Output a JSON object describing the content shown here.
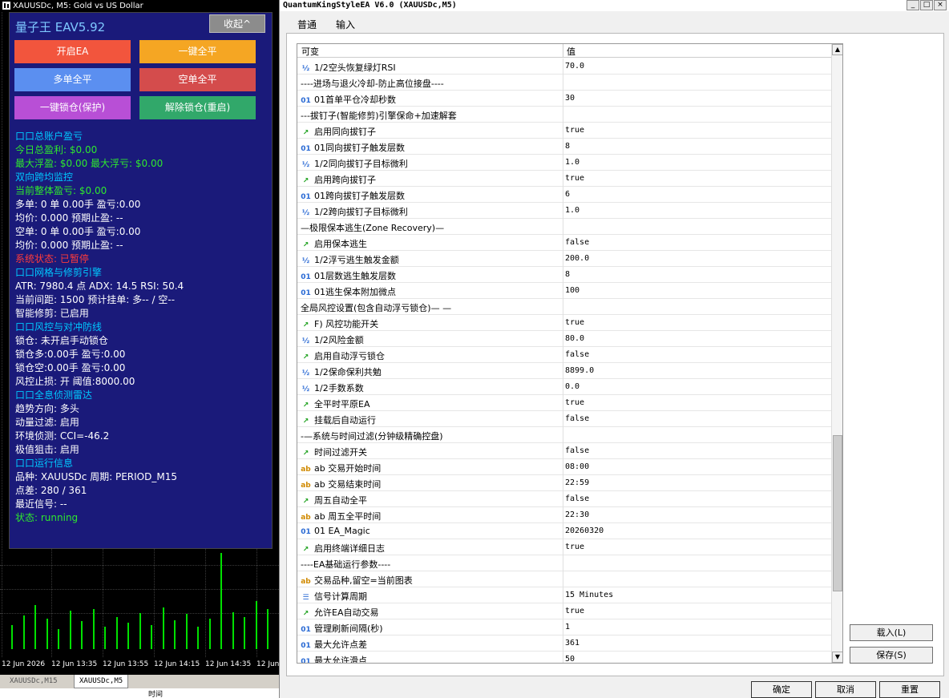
{
  "chart_window": {
    "title": "XAUUSDc, M5:  Gold vs US Dollar",
    "time_labels": [
      "12 Jun 2026",
      "12 Jun 13:35",
      "12 Jun 13:55",
      "12 Jun 14:15",
      "12 Jun 14:35",
      "12 Jun"
    ],
    "tabs": [
      "XAUUSDc,M15",
      "XAUUSDc,M5"
    ],
    "bottom_label": "时间"
  },
  "ea_panel": {
    "title": "量子王 EAV5.92",
    "collapse_label": "收起^",
    "buttons": {
      "start": "开启EA",
      "close_all": "一键全平",
      "close_long": "多单全平",
      "close_short": "空单全平",
      "lock": "一键锁仓(保护)",
      "unlock": "解除锁仓(重启)"
    },
    "lines": [
      {
        "text": "口口总账户盈亏",
        "color": "cyan"
      },
      {
        "text": "今日总盈利: $0.00",
        "color": "green"
      },
      {
        "text": "最大浮盈: $0.00     最大浮亏: $0.00",
        "color": "green"
      },
      {
        "text": "双向跨均监控",
        "color": "cyan"
      },
      {
        "text": "当前整体盈亏: $0.00",
        "color": "green"
      },
      {
        "text": "多单: 0 单 0.00手 盈亏:0.00",
        "color": "white"
      },
      {
        "text": "均价: 0.000 预期止盈: --",
        "color": "white"
      },
      {
        "text": "空单: 0 单 0.00手 盈亏:0.00",
        "color": "white"
      },
      {
        "text": "均价: 0.000 预期止盈: --",
        "color": "white"
      },
      {
        "text": "系统状态: 已暂停",
        "color": "red"
      },
      {
        "text": "口口网格与修剪引擎",
        "color": "cyan"
      },
      {
        "text": "ATR: 7980.4 点  ADX: 14.5  RSI: 50.4",
        "color": "white"
      },
      {
        "text": "当前间距: 1500  预计挂单: 多-- / 空--",
        "color": "white"
      },
      {
        "text": "智能修剪: 已启用",
        "color": "white"
      },
      {
        "text": "口口风控与对冲防线",
        "color": "cyan"
      },
      {
        "text": "锁仓: 未开启手动锁仓",
        "color": "white"
      },
      {
        "text": "锁仓多:0.00手 盈亏:0.00",
        "color": "white"
      },
      {
        "text": "锁仓空:0.00手 盈亏:0.00",
        "color": "white"
      },
      {
        "text": "风控止损: 开  阈值:8000.00",
        "color": "white"
      },
      {
        "text": "口口全息侦测雷达",
        "color": "cyan"
      },
      {
        "text": "趋势方向: 多头",
        "color": "white"
      },
      {
        "text": "动量过滤: 启用",
        "color": "white"
      },
      {
        "text": "环境侦测: CCI=-46.2",
        "color": "white"
      },
      {
        "text": "极值狙击: 启用",
        "color": "white"
      },
      {
        "text": "口口运行信息",
        "color": "cyan"
      },
      {
        "text": "品种: XAUUSDc  周期: PERIOD_M15",
        "color": "white"
      },
      {
        "text": "点差: 280 / 361",
        "color": "white"
      },
      {
        "text": "最近信号: --",
        "color": "white"
      },
      {
        "text": "状态: running",
        "color": "green"
      }
    ]
  },
  "dialog": {
    "title": "QuantumKingStyleEA V6.0 (XAUUSDc,M5)",
    "tabs": {
      "common": "普通",
      "input": "输入"
    },
    "columns": {
      "name": "可变",
      "value": "值"
    },
    "rows": [
      {
        "icon": "½",
        "type": "dbl",
        "name": "1/2空头恢复绿灯RSI",
        "value": "70.0"
      },
      {
        "icon": "",
        "type": "section",
        "name": "----进场与退火冷却-防止高位接盘----",
        "value": ""
      },
      {
        "icon": "01",
        "type": "int",
        "name": "01首单平仓冷却秒数",
        "value": "30"
      },
      {
        "icon": "",
        "type": "section",
        "name": "---拔钉子(智能修剪)引擎保命+加速解套",
        "value": ""
      },
      {
        "icon": "↗",
        "type": "bool",
        "name": "启用同向拔钉子",
        "value": "true"
      },
      {
        "icon": "01",
        "type": "int",
        "name": "01同向拔钉子触发层数",
        "value": "8"
      },
      {
        "icon": "½",
        "type": "dbl",
        "name": "1/2同向拔钉子目标微利",
        "value": "1.0"
      },
      {
        "icon": "↗",
        "type": "bool",
        "name": "启用跨向拔钉子",
        "value": "true"
      },
      {
        "icon": "01",
        "type": "int",
        "name": "01跨向拔钉子触发层数",
        "value": "6"
      },
      {
        "icon": "½",
        "type": "dbl",
        "name": "1/2跨向拔钉子目标微利",
        "value": "1.0"
      },
      {
        "icon": "",
        "type": "section",
        "name": "—极限保本逃生(Zone Recovery)—",
        "value": ""
      },
      {
        "icon": "↗",
        "type": "bool",
        "name": "启用保本逃生",
        "value": "false"
      },
      {
        "icon": "½",
        "type": "dbl",
        "name": "1/2浮亏逃生触发金额",
        "value": "200.0"
      },
      {
        "icon": "01",
        "type": "int",
        "name": "01层数逃生触发层数",
        "value": "8"
      },
      {
        "icon": "01",
        "type": "int",
        "name": "01逃生保本附加微点",
        "value": "100"
      },
      {
        "icon": "",
        "type": "section",
        "name": "全局风控设置(包含自动浮亏锁仓)— —",
        "value": ""
      },
      {
        "icon": "↗",
        "type": "bool",
        "name": "F) 风控功能开关",
        "value": "true"
      },
      {
        "icon": "½",
        "type": "dbl",
        "name": "1/2风险金额",
        "value": "80.0"
      },
      {
        "icon": "↗",
        "type": "bool",
        "name": "启用自动浮亏锁仓",
        "value": "false"
      },
      {
        "icon": "½",
        "type": "dbl",
        "name": "1/2保命保利共勉",
        "value": "8899.0"
      },
      {
        "icon": "½",
        "type": "dbl",
        "name": "1/2手数系数",
        "value": "0.0"
      },
      {
        "icon": "↗",
        "type": "bool",
        "name": "全平时平原EA",
        "value": "true"
      },
      {
        "icon": "↗",
        "type": "bool",
        "name": "挂载后自动运行",
        "value": "false"
      },
      {
        "icon": "",
        "type": "section",
        "name": "-—系统与时间过滤(分钟级精确控盘)",
        "value": ""
      },
      {
        "icon": "↗",
        "type": "bool",
        "name": "时间过滤开关",
        "value": "false"
      },
      {
        "icon": "ab",
        "type": "str",
        "name": "ab 交易开始时间",
        "value": "08:00"
      },
      {
        "icon": "ab",
        "type": "str",
        "name": "ab 交易结束时间",
        "value": "22:59"
      },
      {
        "icon": "↗",
        "type": "bool",
        "name": "周五自动全平",
        "value": "false"
      },
      {
        "icon": "ab",
        "type": "str",
        "name": "ab 周五全平时间",
        "value": "22:30"
      },
      {
        "icon": "01",
        "type": "int",
        "name": "01 EA_Magic",
        "value": "20260320"
      },
      {
        "icon": "↗",
        "type": "bool",
        "name": "启用终端详细日志",
        "value": "true"
      },
      {
        "icon": "",
        "type": "section",
        "name": "----EA基础运行参数----",
        "value": ""
      },
      {
        "icon": "ab",
        "type": "str",
        "name": "交易品种,留空=当前图表",
        "value": ""
      },
      {
        "icon": "☰",
        "type": "enum",
        "name": "信号计算周期",
        "value": "15 Minutes"
      },
      {
        "icon": "↗",
        "type": "bool",
        "name": "允许EA自动交易",
        "value": "true"
      },
      {
        "icon": "01",
        "type": "int",
        "name": "管理刷新间隔(秒)",
        "value": "1"
      },
      {
        "icon": "01",
        "type": "int",
        "name": "最大允许点差",
        "value": "361"
      },
      {
        "icon": "01",
        "type": "int",
        "name": "最大允许滑点",
        "value": "50"
      }
    ],
    "buttons": {
      "load": "载入(L)",
      "save": "保存(S)",
      "ok": "确定",
      "cancel": "取消",
      "reset": "重置"
    }
  }
}
